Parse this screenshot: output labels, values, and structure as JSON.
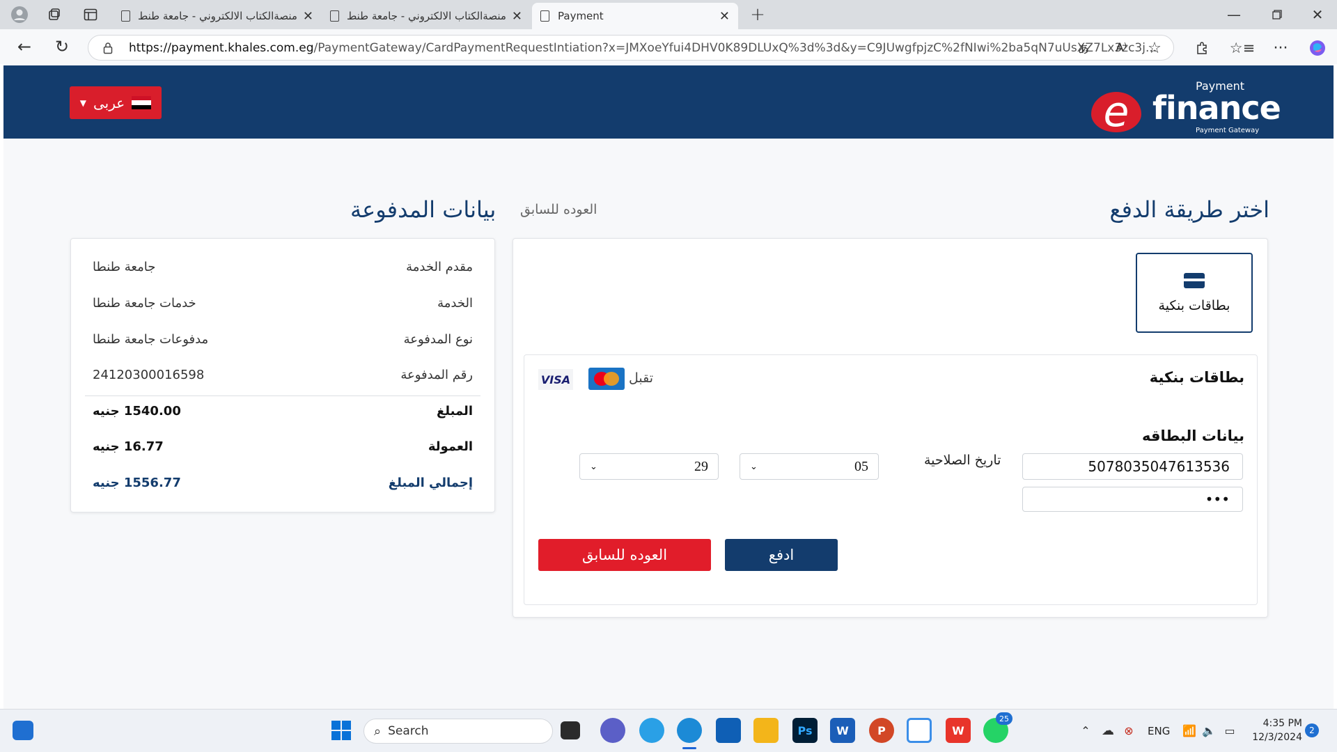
{
  "browser": {
    "tabs": [
      {
        "title": "منصةالكتاب الالكتروني - جامعة طنطا"
      },
      {
        "title": "منصةالكتاب الالكتروني - جامعة طنطا"
      },
      {
        "title": "Payment"
      }
    ],
    "url_host": "https://payment.khales.com.eg",
    "url_path": "/PaymentGateway/CardPaymentRequestIntiation?x=JMXoeYfui4DHV0K89DLUxQ%3d%3d&y=C9JUwgfpjzC%2fNIwi%2ba5qN7uUsXZ7Lx3zc3j..."
  },
  "header": {
    "lang_label": "عربى",
    "logo_payment": "Payment",
    "logo_brand": "finance",
    "logo_sub": "Payment Gateway"
  },
  "left": {
    "title": "اختر طريقة الدفع",
    "back_link": "العوده للسابق",
    "method_label": "بطاقات بنكية",
    "section_title": "بطاقات بنكية",
    "accept_label": "تقبل",
    "visa_label": "VISA",
    "mastercard_label": "MasterCard",
    "card_data_label": "بيانات البطاقه",
    "card_number": "5078035047613536",
    "expiry_label": "تاريخ الصلاحية",
    "expiry_month": "05",
    "expiry_year": "29",
    "cvv": "•••",
    "pay_button": "ادفع",
    "back_button": "العوده للسابق"
  },
  "right": {
    "title": "بيانات المدفوعة",
    "rows": [
      {
        "key": "مقدم الخدمة",
        "value": "جامعة طنطا"
      },
      {
        "key": "الخدمة",
        "value": "خدمات جامعة طنطا"
      },
      {
        "key": "نوع المدفوعة",
        "value": "مدفوعات جامعة طنطا"
      },
      {
        "key": "رقم المدفوعة",
        "value": "24120300016598"
      }
    ],
    "amount_label": "المبلغ",
    "amount_value": "1540.00 جنيه",
    "fee_label": "العمولة",
    "fee_value": "16.77 جنيه",
    "total_label": "إجمالي المبلغ",
    "total_value": "1556.77 جنيه"
  },
  "taskbar": {
    "search_label": "Search",
    "lang": "ENG",
    "time": "4:35 PM",
    "date": "12/3/2024",
    "whatsapp_badge": "25",
    "notif_count": "2"
  },
  "colors": {
    "brand_blue": "#133c6d",
    "brand_red": "#d91e2b"
  }
}
